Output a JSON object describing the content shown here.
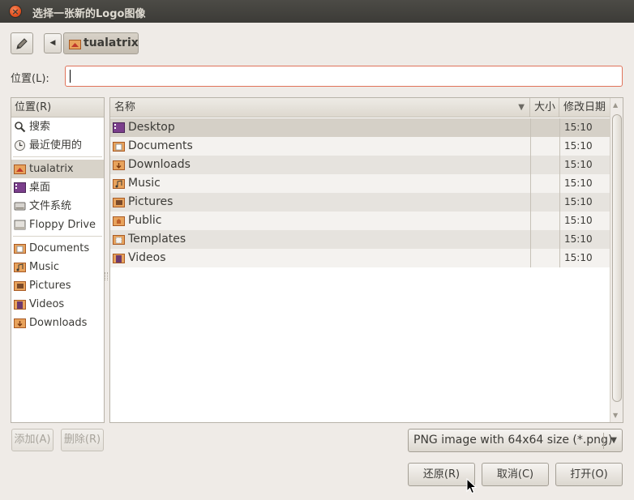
{
  "window": {
    "title": "选择一张新的Logo图像"
  },
  "path_bar": {
    "current": "tualatrix"
  },
  "location": {
    "label": "位置(L):",
    "value": ""
  },
  "places": {
    "header": "位置(R)",
    "items": [
      {
        "label": "搜索",
        "icon": "search-icon"
      },
      {
        "label": "最近使用的",
        "icon": "recent-icon"
      },
      {
        "label": "tualatrix",
        "icon": "home-folder-icon",
        "selected": true
      },
      {
        "label": "桌面",
        "icon": "desktop-icon"
      },
      {
        "label": "文件系统",
        "icon": "filesystem-icon"
      },
      {
        "label": "Floppy Drive",
        "icon": "floppy-icon"
      },
      {
        "label": "Documents",
        "icon": "documents-folder-icon"
      },
      {
        "label": "Music",
        "icon": "music-folder-icon"
      },
      {
        "label": "Pictures",
        "icon": "pictures-folder-icon"
      },
      {
        "label": "Videos",
        "icon": "videos-folder-icon"
      },
      {
        "label": "Downloads",
        "icon": "downloads-folder-icon"
      }
    ]
  },
  "files": {
    "columns": {
      "name": "名称",
      "size": "大小",
      "modified": "修改日期"
    },
    "rows": [
      {
        "name": "Desktop",
        "size": "",
        "modified": "15:10",
        "icon": "desktop-icon"
      },
      {
        "name": "Documents",
        "size": "",
        "modified": "15:10",
        "icon": "documents-folder-icon"
      },
      {
        "name": "Downloads",
        "size": "",
        "modified": "15:10",
        "icon": "downloads-folder-icon"
      },
      {
        "name": "Music",
        "size": "",
        "modified": "15:10",
        "icon": "music-folder-icon"
      },
      {
        "name": "Pictures",
        "size": "",
        "modified": "15:10",
        "icon": "pictures-folder-icon"
      },
      {
        "name": "Public",
        "size": "",
        "modified": "15:10",
        "icon": "public-folder-icon"
      },
      {
        "name": "Templates",
        "size": "",
        "modified": "15:10",
        "icon": "templates-folder-icon"
      },
      {
        "name": "Videos",
        "size": "",
        "modified": "15:10",
        "icon": "videos-folder-icon"
      }
    ]
  },
  "buttons": {
    "add": "添加(A)",
    "remove": "删除(R)",
    "revert": "还原(R)",
    "cancel": "取消(C)",
    "open": "打开(O)"
  },
  "filter": {
    "selected": "PNG image with 64x64 size (*.png)"
  },
  "colors": {
    "folder": "#e8a35c",
    "folder_dark": "#c0622b",
    "selection": "#d5d0c7",
    "input_border": "#e0735a"
  }
}
